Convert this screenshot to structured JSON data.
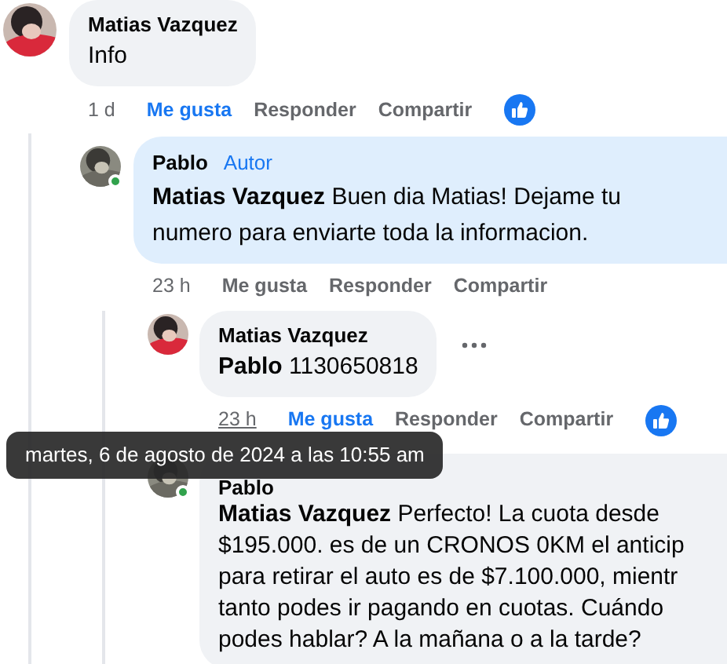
{
  "comments": [
    {
      "author": "Matias Vazquez",
      "text": "Info",
      "time": "1 d",
      "liked": true,
      "reaction": true,
      "actions": [
        "Me gusta",
        "Responder",
        "Compartir"
      ],
      "replies": [
        {
          "author": "Pablo",
          "badge": "Autor",
          "online": true,
          "highlighted": true,
          "text": "**Matias Vazquez** Buen dia Matias! Dejame tu\nnumero para enviarte toda la informacion.",
          "time": "23 h",
          "liked": false,
          "actions": [
            "Me gusta",
            "Responder",
            "Compartir"
          ],
          "replies": [
            {
              "author": "Matias Vazquez",
              "text": "**Pablo** 1130650818",
              "time": "23 h",
              "time_hovered": true,
              "liked": true,
              "reaction": true,
              "more": true,
              "actions": [
                "Me gusta",
                "Responder",
                "Compartir"
              ]
            },
            {
              "author": "Pablo",
              "online": true,
              "text": "**Matias Vazquez** Perfecto! La cuota desde\n$195.000. es de un CRONOS 0KM el anticip\npara retirar el auto es de $7.100.000, mientr\ntanto podes ir pagando en cuotas. Cuándo\npodes hablar? A la mañana o a la tarde?"
            }
          ]
        }
      ]
    }
  ],
  "tooltip": "martes, 6 de agosto de 2024 a las 10:55 am"
}
